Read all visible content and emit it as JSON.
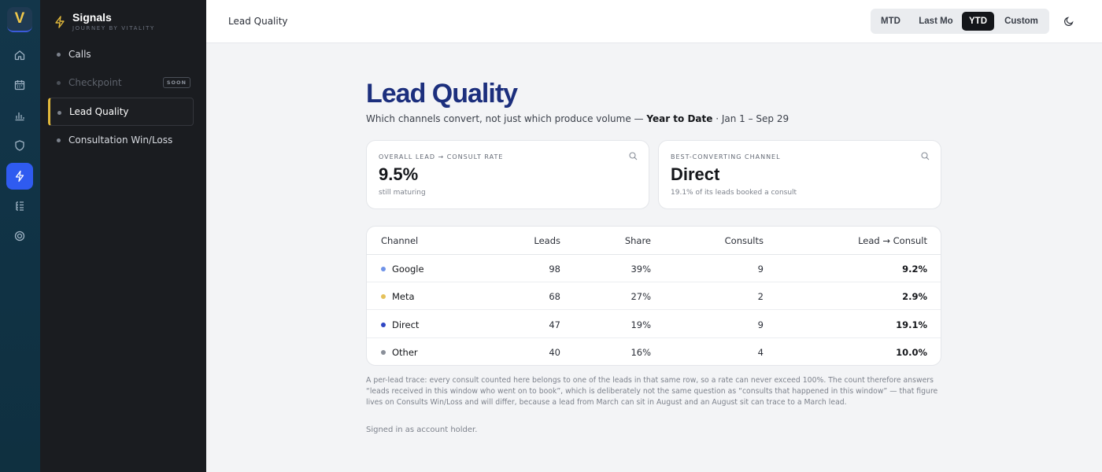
{
  "app": {
    "logo_letter": "V",
    "brand_title": "Signals",
    "brand_subtitle": "JOURNEY BY VITALITY"
  },
  "rail": {
    "items": [
      {
        "icon": "home-icon"
      },
      {
        "icon": "calendar-icon"
      },
      {
        "icon": "bar-chart-icon"
      },
      {
        "icon": "shield-icon"
      },
      {
        "icon": "bolt-icon",
        "active": true
      },
      {
        "icon": "tree-list-icon"
      },
      {
        "icon": "target-icon"
      }
    ]
  },
  "sidebar": {
    "items": [
      {
        "label": "Calls"
      },
      {
        "label": "Checkpoint",
        "badge": "SOON",
        "disabled": true
      },
      {
        "label": "Lead Quality",
        "active": true
      },
      {
        "label": "Consultation Win/Loss"
      }
    ]
  },
  "topbar": {
    "breadcrumb": "Lead Quality",
    "ranges": [
      "MTD",
      "Last Mo",
      "YTD",
      "Custom"
    ],
    "selected_range": "YTD"
  },
  "page": {
    "title": "Lead Quality",
    "subtitle_prefix": "Which channels convert, not just which produce volume —",
    "subtitle_period": "Year to Date",
    "subtitle_dates": "· Jan 1 – Sep 29"
  },
  "cards": [
    {
      "label": "OVERALL LEAD → CONSULT RATE",
      "value": "9.5%",
      "note": "still maturing"
    },
    {
      "label": "BEST-CONVERTING CHANNEL",
      "value": "Direct",
      "note": "19.1% of its leads booked a consult"
    }
  ],
  "table": {
    "headers": {
      "channel": "Channel",
      "leads": "Leads",
      "share": "Share",
      "consults": "Consults",
      "rate": "Lead → Consult"
    },
    "rows": [
      {
        "channel": "Google",
        "leads": "98",
        "share": "39%",
        "consults": "9",
        "rate": "9.2%",
        "color": "#6f93e8"
      },
      {
        "channel": "Meta",
        "leads": "68",
        "share": "27%",
        "consults": "2",
        "rate": "2.9%",
        "color": "#e5c15a"
      },
      {
        "channel": "Direct",
        "leads": "47",
        "share": "19%",
        "consults": "9",
        "rate": "19.1%",
        "color": "#2f46c4"
      },
      {
        "channel": "Other",
        "leads": "40",
        "share": "16%",
        "consults": "4",
        "rate": "10.0%",
        "color": "#8a8f99"
      }
    ]
  },
  "footnote": "A per-lead trace: every consult counted here belongs to one of the leads in that same row, so a rate can never exceed 100%. The count therefore answers “leads received in this window who went on to book”, which is deliberately not the same question as “consults that happened in this window” — that figure lives on Consults Win/Loss and will differ, because a lead from March can sit in August and an August sit can trace to a March lead.",
  "signed_in": "Signed in as account holder."
}
